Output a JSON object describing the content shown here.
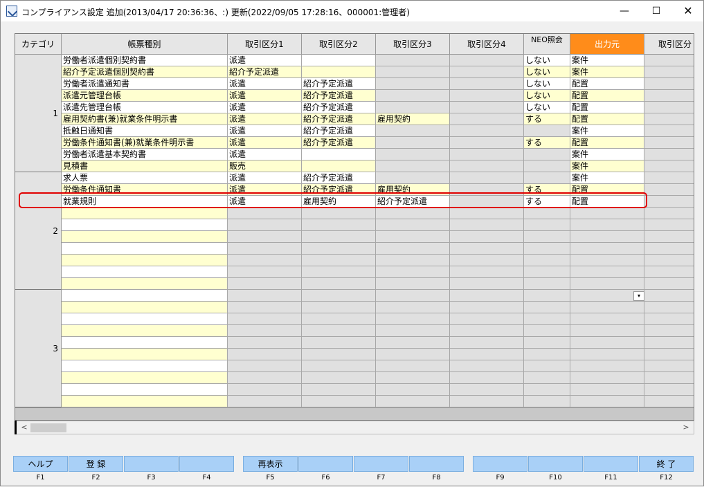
{
  "window": {
    "title": "コンプライアンス設定 追加(2013/04/17 20:36:36、:) 更新(2022/09/05 17:28:16、000001:管理者)",
    "minimize": "—",
    "maximize": "☐",
    "close": "✕"
  },
  "grid": {
    "headers": {
      "category": "カテゴリ",
      "form_type": "帳票種別",
      "trade1": "取引区分1",
      "trade2": "取引区分2",
      "trade3": "取引区分3",
      "trade4": "取引区分4",
      "neo": "NEO照会",
      "output": "出力元",
      "trade5": "取引区分"
    },
    "categories": [
      "1",
      "2",
      "3"
    ],
    "rows": [
      [
        "労働者派遣個別契約書",
        "派遣",
        "",
        "",
        "",
        "しない",
        "案件"
      ],
      [
        "紹介予定派遣個別契約書",
        "紹介予定派遣",
        "",
        "",
        "",
        "しない",
        "案件"
      ],
      [
        "労働者派遣通知書",
        "派遣",
        "紹介予定派遣",
        "",
        "",
        "しない",
        "配置"
      ],
      [
        "派遣元管理台帳",
        "派遣",
        "紹介予定派遣",
        "",
        "",
        "しない",
        "配置"
      ],
      [
        "派遣先管理台帳",
        "派遣",
        "紹介予定派遣",
        "",
        "",
        "しない",
        "配置"
      ],
      [
        "雇用契約書(兼)就業条件明示書",
        "派遣",
        "紹介予定派遣",
        "雇用契約",
        "",
        "する",
        "配置"
      ],
      [
        "抵触日通知書",
        "派遣",
        "紹介予定派遣",
        "",
        "",
        "",
        "案件"
      ],
      [
        "労働条件通知書(兼)就業条件明示書",
        "派遣",
        "紹介予定派遣",
        "",
        "",
        "する",
        "配置"
      ],
      [
        "労働者派遣基本契約書",
        "派遣",
        "",
        "",
        "",
        "",
        "案件"
      ],
      [
        "見積書",
        "販売",
        "",
        "",
        "",
        "",
        "案件"
      ],
      [
        "求人票",
        "派遣",
        "紹介予定派遣",
        "",
        "",
        "",
        "案件"
      ],
      [
        "労働条件通知書",
        "派遣",
        "紹介予定派遣",
        "雇用契約",
        "",
        "する",
        "配置"
      ],
      [
        "就業規則",
        "派遣",
        "雇用契約",
        "紹介予定派遣",
        "",
        "する",
        "配置"
      ]
    ],
    "dropdown_icon": "▾"
  },
  "scrollbar": {
    "left_arrow": "<",
    "right_arrow": ">"
  },
  "fkeys": [
    {
      "key": "F1",
      "label": "ヘルプ"
    },
    {
      "key": "F2",
      "label": "登 録"
    },
    {
      "key": "F3",
      "label": ""
    },
    {
      "key": "F4",
      "label": ""
    },
    {
      "key": "F5",
      "label": "再表示"
    },
    {
      "key": "F6",
      "label": ""
    },
    {
      "key": "F7",
      "label": ""
    },
    {
      "key": "F8",
      "label": ""
    },
    {
      "key": "F9",
      "label": ""
    },
    {
      "key": "F10",
      "label": ""
    },
    {
      "key": "F11",
      "label": ""
    },
    {
      "key": "F12",
      "label": "終 了"
    }
  ]
}
